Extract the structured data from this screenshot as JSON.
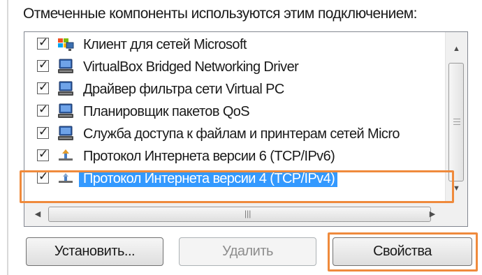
{
  "header": {
    "label": "Отмеченные компоненты используются этим подключением:"
  },
  "components": [
    {
      "label": "Клиент для сетей Microsoft",
      "checked": true,
      "icon": "network-client-icon",
      "selected": false
    },
    {
      "label": "VirtualBox Bridged Networking Driver",
      "checked": true,
      "icon": "network-service-icon",
      "selected": false
    },
    {
      "label": "Драйвер фильтра сети Virtual PC",
      "checked": true,
      "icon": "network-service-icon",
      "selected": false
    },
    {
      "label": "Планировщик пакетов QoS",
      "checked": true,
      "icon": "network-service-icon",
      "selected": false
    },
    {
      "label": "Служба доступа к файлам и принтерам сетей Micro",
      "checked": true,
      "icon": "network-service-icon",
      "selected": false
    },
    {
      "label": "Протокол Интернета версии 6 (TCP/IPv6)",
      "checked": true,
      "icon": "protocol-icon",
      "selected": false
    },
    {
      "label": "Протокол Интернета версии 4 (TCP/IPv4)",
      "checked": true,
      "icon": "protocol-icon",
      "selected": true
    }
  ],
  "buttons": {
    "install": "Установить...",
    "remove": "Удалить",
    "properties": "Свойства"
  },
  "colors": {
    "selection": "#3399ff",
    "highlight_frame": "#ef8a3c"
  }
}
